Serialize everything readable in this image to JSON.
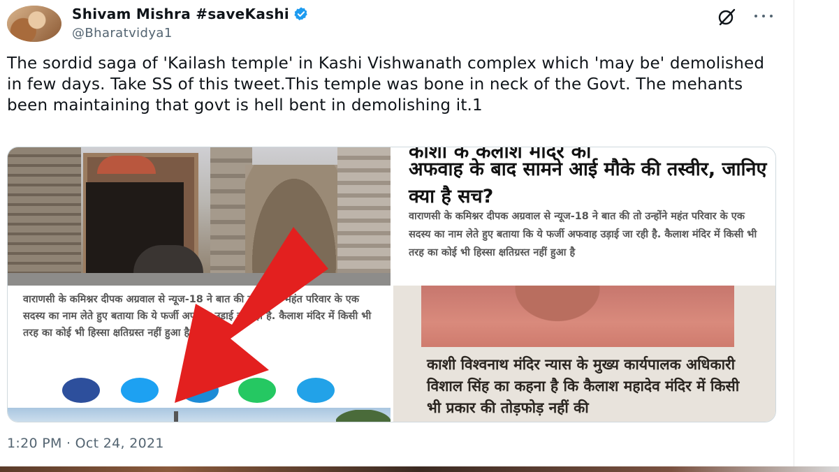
{
  "author": {
    "name": "Shivam Mishra #saveKashi",
    "handle": "@Bharatvidya1",
    "verified_color": "#1d9bf0"
  },
  "header_icons": [
    "grok-icon",
    "more-icon"
  ],
  "tweet": {
    "text": "The sordid saga of 'Kailash temple' in Kashi Vishwanath complex which 'may be' demolished in few days. Take SS of this tweet.This temple was bone in neck of the Govt. The mehants been maintaining that govt is hell bent in demolishing it.1",
    "timestamp": "1:20 PM · Oct 24, 2021"
  },
  "media": {
    "top_right": {
      "cut_line": "काशी के कैलाश मंदिर को",
      "headline": "अफवाह के बाद सामने आई मौके की तस्वीर, जानिए क्या है सच?",
      "body": "वाराणसी के कमिश्नर दीपक अग्रवाल से न्यूज-18 ने बात की तो उन्होंने महंत परिवार के एक सदस्य का नाम लेते हुए बताया कि ये फर्जी अफवाह उड़ाई जा रही है. कैलाश मंदिर में किसी भी तरह का कोई भी हिस्सा क्षतिग्रस्त नहीं हुआ है"
    },
    "bottom_left": {
      "body": "वाराणसी के कमिश्नर दीपक अग्रवाल से न्यूज-18 ने बात की तो उन्होंने महंत परिवार के एक सदस्य का नाम लेते हुए बताया कि ये फर्जी अफवाह उड़ाई जा रही है. कैलाश मंदिर में किसी भी तरह का कोई भी हिस्सा क्षतिग्रस्त नहीं हुआ है.",
      "share_buttons": [
        {
          "name": "facebook",
          "color": "#2d4f9c"
        },
        {
          "name": "twitter",
          "color": "#1da1f2"
        },
        {
          "name": "telegram",
          "color": "#1c8bd6"
        },
        {
          "name": "whatsapp",
          "color": "#25c862"
        },
        {
          "name": "share",
          "color": "#22a2e8"
        }
      ]
    },
    "bottom_right": {
      "body": "काशी विश्वनाथ मंदिर न्यास के मुख्य कार्यपालक अधिकारी विशाल सिंह का कहना है कि कैलाश महादेव मंदिर में किसी भी प्रकार की तोड़फोड़ नहीं की"
    },
    "arrow_color": "#e3201f"
  }
}
